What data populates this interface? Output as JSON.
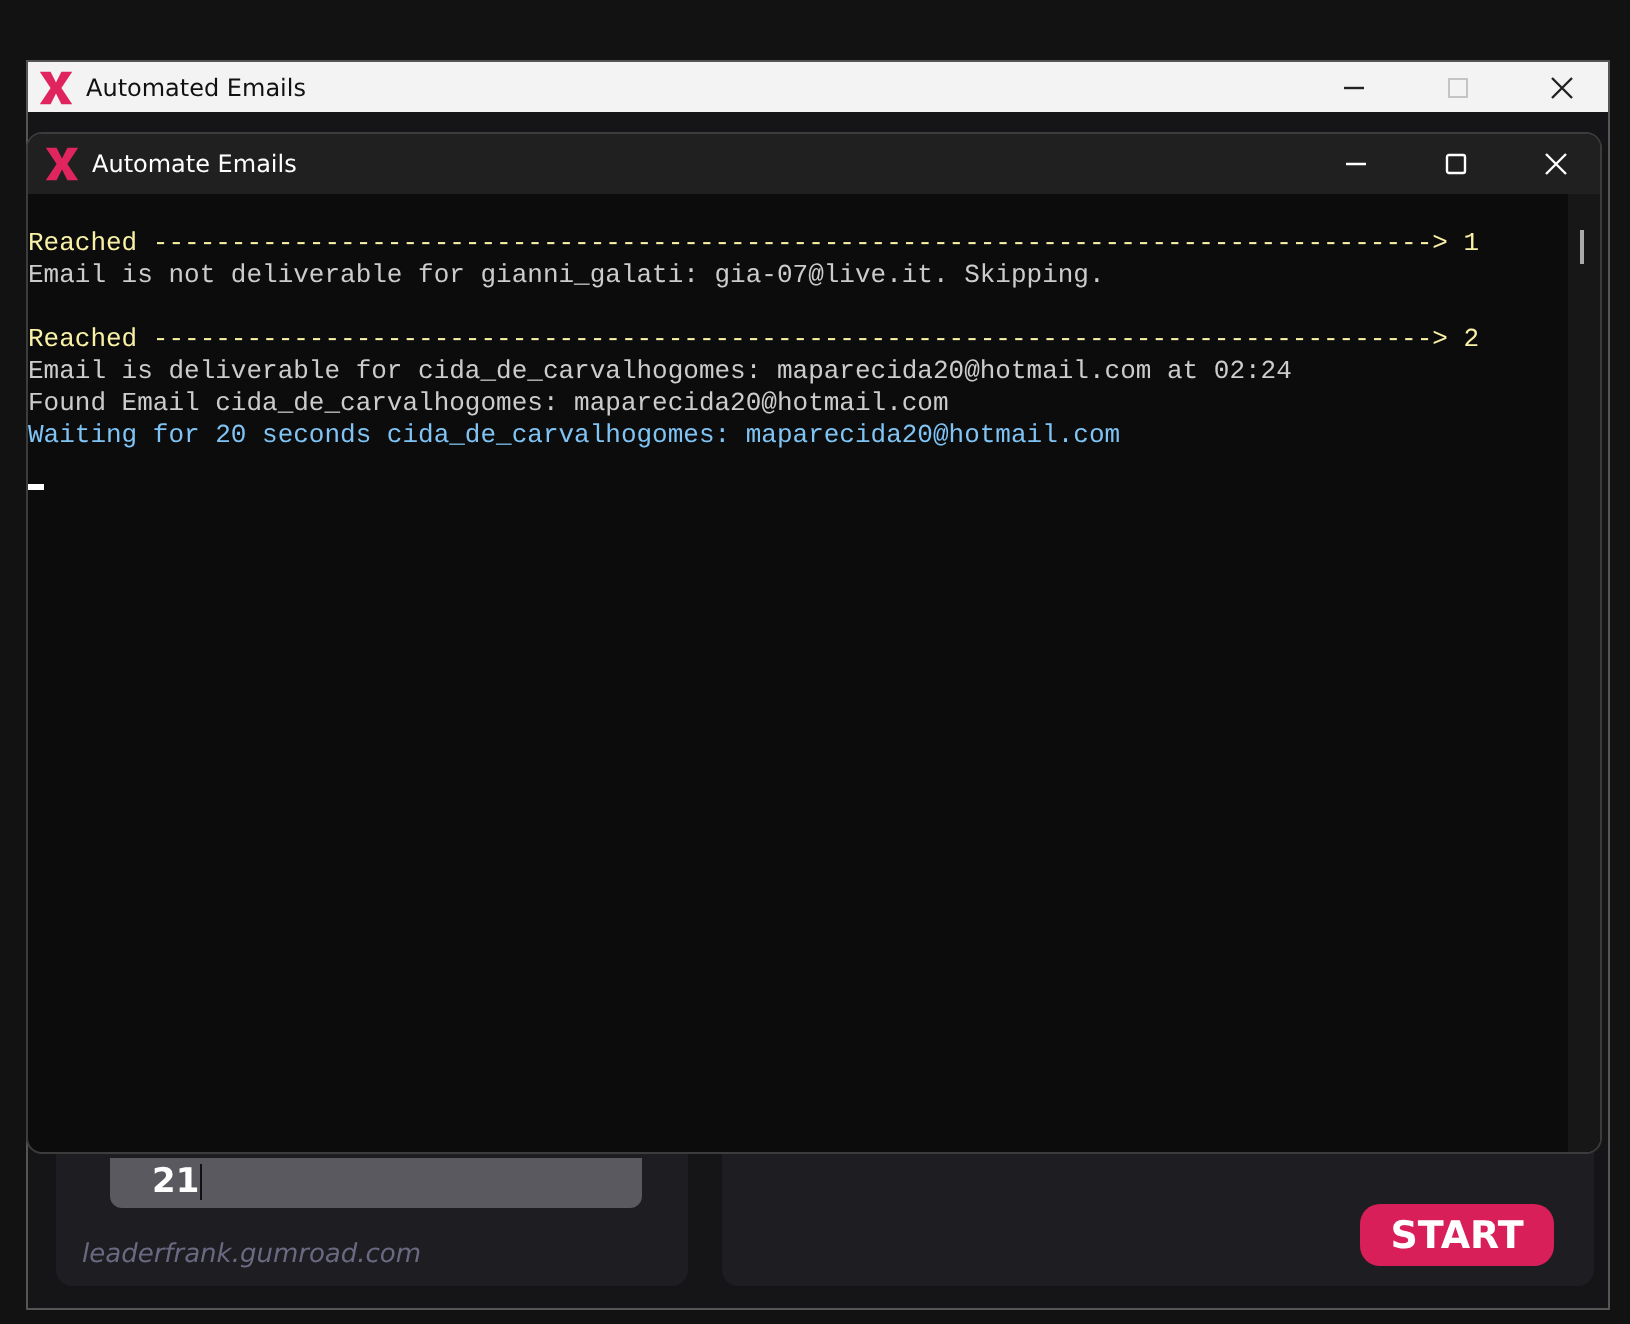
{
  "outer_window": {
    "title": "Automated Emails",
    "maximize_disabled": true,
    "field_value": "21",
    "footer_text": "leaderfrank.gumroad.com",
    "start_button": "START"
  },
  "console_window": {
    "title": "Automate Emails",
    "maximize_disabled": false,
    "blocks": [
      {
        "lines": [
          {
            "text": "Reached ----------------------------------------------------------------------------------> 1",
            "color": "#f9f1a5"
          },
          {
            "text": "Email is not deliverable for gianni_galati: gia-07@live.it. Skipping.",
            "color": "#cccccc"
          }
        ]
      },
      {
        "lines": [
          {
            "text": "Reached ----------------------------------------------------------------------------------> 2",
            "color": "#f9f1a5"
          },
          {
            "text": "Email is deliverable for cida_de_carvalhogomes: maparecida20@hotmail.com at 02:24",
            "color": "#cccccc"
          },
          {
            "text": "Found Email cida_de_carvalhogomes: maparecida20@hotmail.com",
            "color": "#cccccc"
          },
          {
            "text": "Waiting for 20 seconds cida_de_carvalhogomes: maparecida20@hotmail.com",
            "color": "#7fc4f5"
          }
        ]
      }
    ]
  }
}
